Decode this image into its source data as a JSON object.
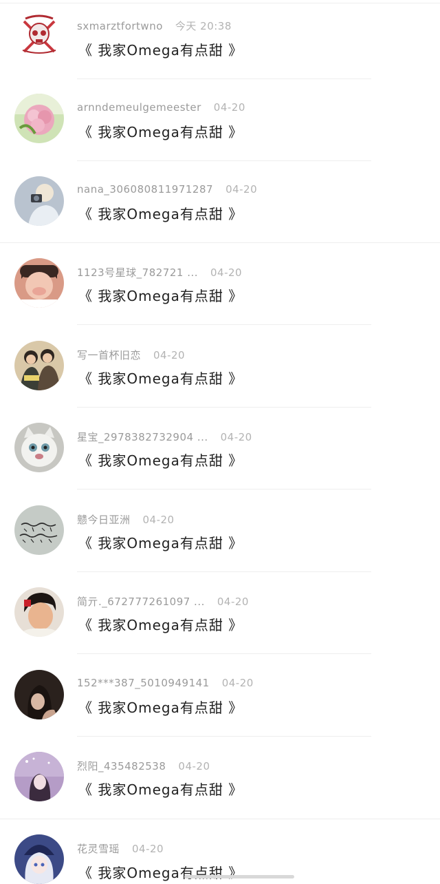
{
  "comments": [
    {
      "username": "sxmarztfortwno",
      "time": "今天 20:38",
      "message": "《 我家Omega有点甜 》",
      "avatar": "skull-logo-avatar"
    },
    {
      "username": "arnndemeulgemeester",
      "time": "04-20",
      "message": "《 我家Omega有点甜 》",
      "avatar": "pink-flower-avatar"
    },
    {
      "username": "nana_306080811971287",
      "time": "04-20",
      "message": "《 我家Omega有点甜 》",
      "avatar": "photographer-avatar"
    },
    {
      "username": "1123号星球_782721 ...",
      "time": "04-20",
      "message": "《 我家Omega有点甜 》",
      "avatar": "laughing-boy-avatar"
    },
    {
      "username": "写一首杯旧恋",
      "time": "04-20",
      "message": "《 我家Omega有点甜 》",
      "avatar": "two-boys-avatar"
    },
    {
      "username": "星宝_2978382732904 ...",
      "time": "04-20",
      "message": "《 我家Omega有点甜 》",
      "avatar": "white-cat-avatar"
    },
    {
      "username": "戆今日亚洲",
      "time": "04-20",
      "message": "《 我家Omega有点甜 》",
      "avatar": "handwriting-avatar"
    },
    {
      "username": "简亓._672777261097 ...",
      "time": "04-20",
      "message": "《 我家Omega有点甜 》",
      "avatar": "boy-portrait-avatar"
    },
    {
      "username": "152***387_5010949141",
      "time": "04-20",
      "message": "《 我家Omega有点甜 》",
      "avatar": "dark-girl-avatar"
    },
    {
      "username": "烈阳_435482538",
      "time": "04-20",
      "message": "《 我家Omega有点甜 》",
      "avatar": "purple-girl-avatar"
    },
    {
      "username": "花灵雪瑶",
      "time": "04-20",
      "message": "《 我家Omega有点甜 》",
      "avatar": "anime-girl-avatar"
    }
  ],
  "colors": {
    "username": "#9a9a9a",
    "time": "#b3b3b3",
    "message": "#222222",
    "divider": "#eeeeee"
  }
}
